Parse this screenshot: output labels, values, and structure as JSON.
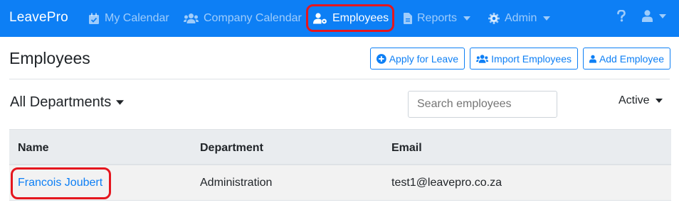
{
  "colors": {
    "navbar": "#0d7ff5",
    "highlight": "#e5161e",
    "link": "#0d7ff5"
  },
  "navbar": {
    "brand": "LeavePro",
    "items": [
      {
        "label": "My Calendar",
        "icon": "calendar-check-icon"
      },
      {
        "label": "Company Calendar",
        "icon": "users-icon"
      },
      {
        "label": "Employees",
        "icon": "user-cog-icon",
        "active": true
      },
      {
        "label": "Reports",
        "icon": "file-icon",
        "dropdown": true
      },
      {
        "label": "Admin",
        "icon": "gear-icon",
        "dropdown": true
      }
    ],
    "help_icon": "question-icon",
    "user_icon": "user-icon"
  },
  "page": {
    "title": "Employees",
    "buttons": {
      "apply_leave": "Apply for Leave",
      "import_employees": "Import Employees",
      "add_employee": "Add Employee"
    },
    "department_filter": "All Departments",
    "search_placeholder": "Search employees",
    "status_filter": "Active"
  },
  "table": {
    "headers": [
      "Name",
      "Department",
      "Email"
    ],
    "rows": [
      {
        "name": "Francois Joubert",
        "department": "Administration",
        "email": "test1@leavepro.co.za"
      }
    ]
  }
}
